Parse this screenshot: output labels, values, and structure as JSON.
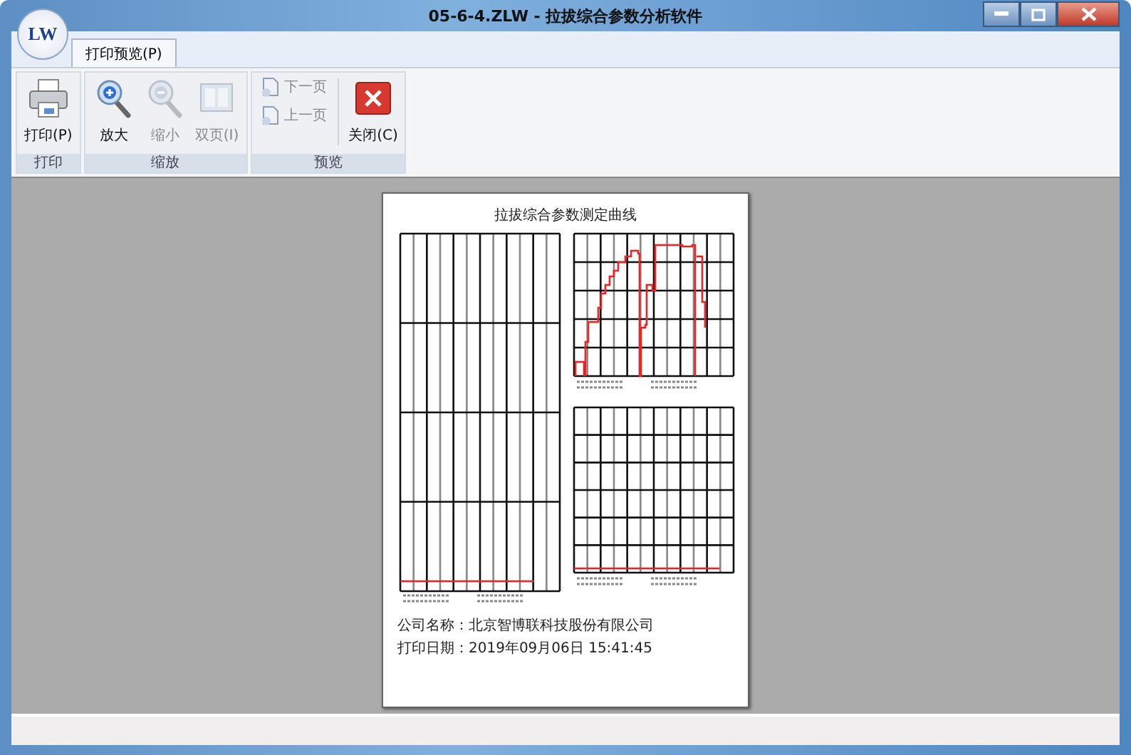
{
  "window": {
    "title": "05-6-4.ZLW - 拉拔综合参数分析软件",
    "logo": "LW"
  },
  "tabs": [
    {
      "label": "打印预览(P)",
      "selected": true
    }
  ],
  "ribbon": [
    {
      "label": "打印",
      "buttons": [
        {
          "label": "打印(P)",
          "kind": "large",
          "disabled": false
        }
      ]
    },
    {
      "label": "缩放",
      "buttons": [
        {
          "label": "放大",
          "kind": "large",
          "disabled": false
        },
        {
          "label": "缩小",
          "kind": "large",
          "disabled": true
        },
        {
          "label": "双页(I)",
          "kind": "large",
          "disabled": true
        }
      ]
    },
    {
      "label": "预览",
      "buttons": [
        {
          "label": "下一页",
          "kind": "small",
          "disabled": true
        },
        {
          "label": "上一页",
          "kind": "small",
          "disabled": true
        },
        {
          "label": "关闭(C)",
          "kind": "large",
          "disabled": false
        }
      ]
    }
  ],
  "page": {
    "title": "拉拔综合参数测定曲线",
    "company": "公司名称：北京智博联科技股份有限公司",
    "print_date": "打印日期：2019年09月06日 15:41:45"
  }
}
